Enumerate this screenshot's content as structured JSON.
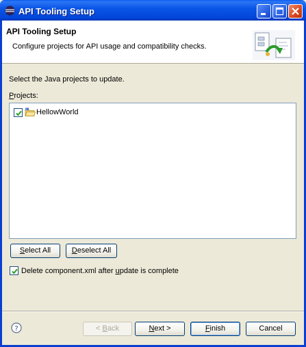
{
  "window": {
    "title": "API Tooling Setup"
  },
  "header": {
    "title": "API Tooling Setup",
    "description": "Configure projects for API usage and compatibility checks."
  },
  "instructions": "Select the Java projects to update.",
  "projects": {
    "label_accel": "P",
    "label_rest": "rojects:",
    "items": [
      {
        "name": "HellowWorld",
        "checked": true
      }
    ]
  },
  "selection_buttons": {
    "select_all": {
      "accel": "S",
      "rest": "elect All"
    },
    "deselect_all": {
      "accel": "D",
      "rest": "eselect All"
    }
  },
  "delete_option": {
    "checked": true,
    "text_before": "Delete component.xml after ",
    "accel": "u",
    "text_after": "pdate is complete"
  },
  "footer": {
    "back": {
      "before": "< ",
      "accel": "B",
      "rest": "ack",
      "enabled": false
    },
    "next": {
      "accel": "N",
      "rest": "ext >"
    },
    "finish": {
      "accel": "F",
      "rest": "inish"
    },
    "cancel": "Cancel"
  },
  "icons": {
    "title": "eclipse-icon",
    "header": "api-tooling-wizard-icon",
    "project": "java-project-folder-icon",
    "help": "help-icon",
    "minimize": "minimize-icon",
    "maximize": "maximize-icon",
    "close": "close-icon"
  },
  "colors": {
    "titlebar": "#0a56e6",
    "dialog_background": "#ece9d8",
    "checkmark": "#21a121",
    "list_border": "#7f9db9"
  }
}
